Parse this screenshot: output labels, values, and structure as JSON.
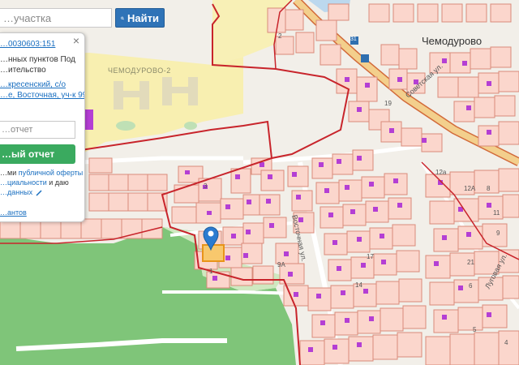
{
  "search": {
    "placeholder": "…участка",
    "button_label": "Найти",
    "button_icon": "search-icon"
  },
  "popup": {
    "close_symbol": "×",
    "cadastral_number": "…0030603:151",
    "category_line1": "…нных пунктов Под",
    "category_line2": "…ительство",
    "address_line1": "…кресенский, с/о",
    "address_line2": "…е, Восточная, уч-к 99",
    "report_placeholder": "…отчет",
    "report_button_label": "…ый отчет",
    "offer_prefix": "…ми ",
    "offer_link_1": "публичной оферты",
    "offer_line2_link": "…циальности",
    "offer_line2_rest": " и даю",
    "offer_line3_link": "…данных",
    "variants_link": "…антов"
  },
  "map": {
    "labels": {
      "village_main": "Чемодурово",
      "village_2": "ЧЕМОДУРОВО-2",
      "street_sovetskaya": "Советская ул.",
      "street_vostochnaya": "Восточная ул.",
      "street_lugovaya": "Луговая ул.",
      "road_sign": "31"
    },
    "house_numbers": [
      "2",
      "19",
      "12a",
      "12А",
      "17",
      "11",
      "14",
      "9",
      "9А",
      "21",
      "3",
      "1",
      "8",
      "6",
      "5",
      "4"
    ],
    "marker_icon": "map-pin-icon",
    "colors": {
      "background": "#f2efe9",
      "parcel_fill": "#fbd6cc",
      "parcel_stroke": "#d98b7a",
      "boundary_red": "#c8242b",
      "forest_green": "#63b96b",
      "forest_light": "#cfe8c0",
      "yellow_zone": "#f8efb0",
      "road_main": "#f3cf8c",
      "road_edge": "#d26a3a",
      "building_magenta": "#b43fd4",
      "marker_blue": "#2b7bd0",
      "selected_orange": "#e8941a"
    }
  }
}
